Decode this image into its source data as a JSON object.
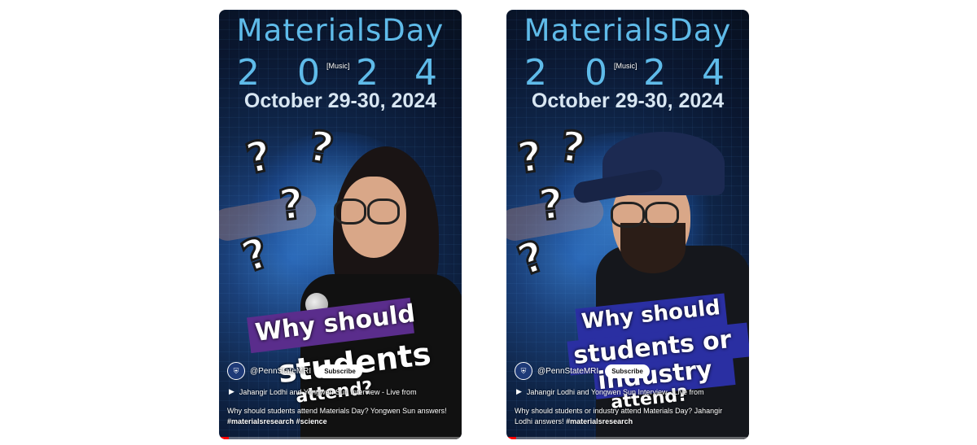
{
  "shorts": [
    {
      "title_line": "MaterialsDay",
      "year_digits": [
        "2",
        "0",
        "2",
        "4"
      ],
      "music_tag": "[Music]",
      "dates": "October 29-30, 2024",
      "banner_lines": [
        "Why should",
        "students",
        "attend?"
      ],
      "channel_name": "@PennStateMRI",
      "subscribe_label": "Subscribe",
      "related_video": "Jahangir Lodhi and Yongwen Sun Interview - Live from",
      "description": "Why should students attend Materials Day? Yongwen Sun answers!",
      "hashtags": "#materialsresearch #science",
      "banner_color": "#5a2d8c"
    },
    {
      "title_line": "MaterialsDay",
      "year_digits": [
        "2",
        "0",
        "2",
        "4"
      ],
      "music_tag": "[Music]",
      "dates": "October 29-30, 2024",
      "banner_lines": [
        "Why should",
        "students or",
        "industry",
        "attend?"
      ],
      "channel_name": "@PennStateMRI",
      "subscribe_label": "Subscribe",
      "related_video": "Jahangir Lodhi and Yongwen Sun Interview - Live from",
      "description": "Why should students or industry attend Materials Day? Jahangir Lodhi answers!",
      "hashtags": "#materialsresearch",
      "banner_color": "#2a2fa2"
    }
  ],
  "icons": {
    "question_mark": "?",
    "play": "▶",
    "channel_logo": "shield-icon"
  }
}
